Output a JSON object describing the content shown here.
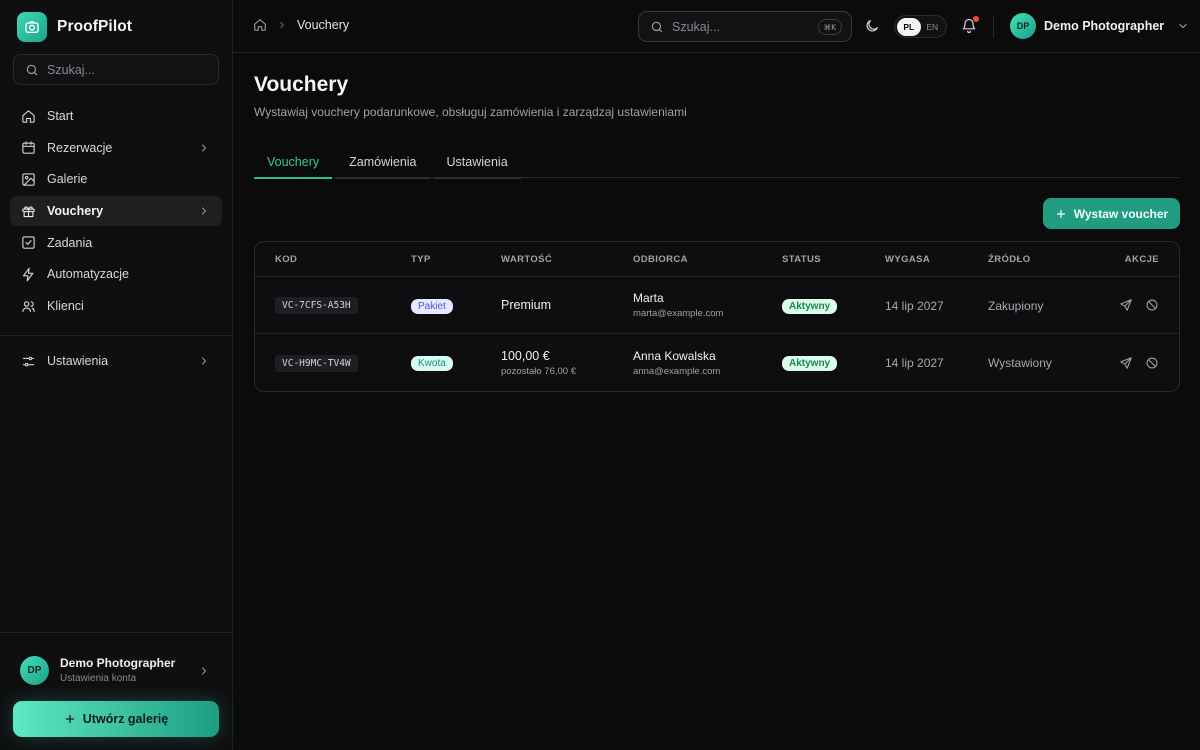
{
  "brand": {
    "name": "ProofPilot",
    "logo_icon": "camera-icon",
    "accent": "#2bbd9b"
  },
  "sidebar": {
    "search_placeholder": "Szukaj...",
    "items": [
      {
        "label": "Start",
        "icon": "home-icon",
        "has_chevron": false,
        "active": false
      },
      {
        "label": "Rezerwacje",
        "icon": "calendar-icon",
        "has_chevron": true,
        "active": false
      },
      {
        "label": "Galerie",
        "icon": "image-icon",
        "has_chevron": false,
        "active": false
      },
      {
        "label": "Vouchery",
        "icon": "gift-icon",
        "has_chevron": true,
        "active": true
      },
      {
        "label": "Zadania",
        "icon": "checkbox-icon",
        "has_chevron": false,
        "active": false
      },
      {
        "label": "Automatyzacje",
        "icon": "lightning-icon",
        "has_chevron": false,
        "active": false
      },
      {
        "label": "Klienci",
        "icon": "users-icon",
        "has_chevron": false,
        "active": false
      }
    ],
    "settings": {
      "label": "Ustawienia",
      "icon": "sliders-icon"
    },
    "account": {
      "initials": "DP",
      "name": "Demo Photographer",
      "sub": "Ustawienia konta"
    },
    "create_button": "Utwórz galerię"
  },
  "topbar": {
    "breadcrumb": {
      "home_icon": "home-icon",
      "current": "Vouchery"
    },
    "search_placeholder": "Szukaj...",
    "shortcut": "⌘K",
    "languages": {
      "active": "PL",
      "inactive": "EN"
    },
    "user": {
      "initials": "DP",
      "name": "Demo Photographer"
    },
    "has_notification": true
  },
  "page": {
    "title": "Vouchery",
    "subtitle": "Wystawiaj vouchery podarunkowe, obsługuj zamówienia i zarządzaj ustawieniami",
    "tabs": [
      {
        "label": "Vouchery",
        "active": true
      },
      {
        "label": "Zamówienia",
        "active": false
      },
      {
        "label": "Ustawienia",
        "active": false
      }
    ],
    "primary_button": "Wystaw voucher"
  },
  "table": {
    "headers": {
      "kod": "KOD",
      "typ": "TYP",
      "wartosc": "WARTOŚĆ",
      "odbiorca": "ODBIORCA",
      "status": "STATUS",
      "wygasa": "WYGASA",
      "zrodlo": "ŹRÓDŁO",
      "akcje": "AKCJE"
    },
    "rows": [
      {
        "code": "VC-7CFS-A53H",
        "type": "Pakiet",
        "value": "Premium",
        "value_sub": "",
        "recipient_name": "Marta",
        "recipient_email": "marta@example.com",
        "status": "Aktywny",
        "expires": "14 lip 2027",
        "source": "Zakupiony"
      },
      {
        "code": "VC-H9MC-TV4W",
        "type": "Kwota",
        "value": "100,00 €",
        "value_sub": "pozostało 76,00 €",
        "recipient_name": "Anna Kowalska",
        "recipient_email": "anna@example.com",
        "status": "Aktywny",
        "expires": "14 lip 2027",
        "source": "Wystawiony"
      }
    ]
  }
}
